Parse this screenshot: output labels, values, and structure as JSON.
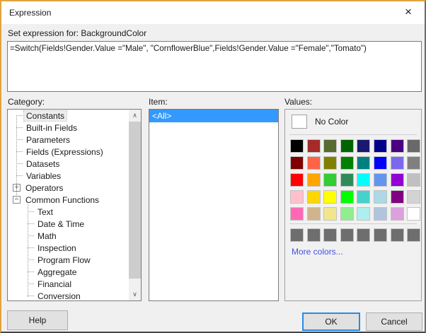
{
  "dialog": {
    "title": "Expression",
    "close_glyph": "×",
    "subtitle": "Set expression for: BackgroundColor",
    "expression": "=Switch(Fields!Gender.Value =\"Male\", \"CornflowerBlue\",Fields!Gender.Value =\"Female\",\"Tomato\")"
  },
  "category": {
    "label": "Category:",
    "items": [
      {
        "label": "Constants",
        "level": 1,
        "selected": true
      },
      {
        "label": "Built-in Fields",
        "level": 1
      },
      {
        "label": "Parameters",
        "level": 1
      },
      {
        "label": "Fields (Expressions)",
        "level": 1
      },
      {
        "label": "Datasets",
        "level": 1
      },
      {
        "label": "Variables",
        "level": 1
      },
      {
        "label": "Operators",
        "level": 0,
        "glyph": "plus"
      },
      {
        "label": "Common Functions",
        "level": 0,
        "glyph": "minus"
      },
      {
        "label": "Text",
        "level": 2
      },
      {
        "label": "Date & Time",
        "level": 2
      },
      {
        "label": "Math",
        "level": 2
      },
      {
        "label": "Inspection",
        "level": 2
      },
      {
        "label": "Program Flow",
        "level": 2
      },
      {
        "label": "Aggregate",
        "level": 2
      },
      {
        "label": "Financial",
        "level": 2
      },
      {
        "label": "Conversion",
        "level": 2
      }
    ],
    "scrollbar": {
      "up_glyph": "∧",
      "down_glyph": "∨"
    }
  },
  "item": {
    "label": "Item:",
    "options": [
      {
        "label": "<All>",
        "selected": true
      }
    ]
  },
  "values": {
    "label": "Values:",
    "no_color_label": "No Color",
    "palette": [
      [
        "#000000",
        "#A52A2A",
        "#556B2F",
        "#006400",
        "#191970",
        "#00008B",
        "#4B0082",
        "#696969"
      ],
      [
        "#800000",
        "#FF6347",
        "#808000",
        "#008000",
        "#008080",
        "#0000FF",
        "#7B68EE",
        "#808080"
      ],
      [
        "#FF0000",
        "#FFA500",
        "#32CD32",
        "#2E8B57",
        "#00FFFF",
        "#6495ED",
        "#9400D3",
        "#C0C0C0"
      ],
      [
        "#FFC0CB",
        "#FFD700",
        "#FFFF00",
        "#00FF00",
        "#48D1CC",
        "#ADD8E6",
        "#800080",
        "#D3D3D3"
      ],
      [
        "#FF69B4",
        "#D2B48C",
        "#F0E68C",
        "#90EE90",
        "#AFEEEE",
        "#B0C4DE",
        "#DDA0DD",
        "#FFFFFF"
      ]
    ],
    "custom_row": [
      "#6E6E6E",
      "#6E6E6E",
      "#6E6E6E",
      "#6E6E6E",
      "#6E6E6E",
      "#6E6E6E",
      "#6E6E6E",
      "#6E6E6E"
    ],
    "more_colors_label": "More colors...",
    "more_colors_color": "#4353E0",
    "selection_color": "#3399FF"
  },
  "buttons": {
    "help": "Help",
    "ok": "OK",
    "cancel": "Cancel"
  }
}
